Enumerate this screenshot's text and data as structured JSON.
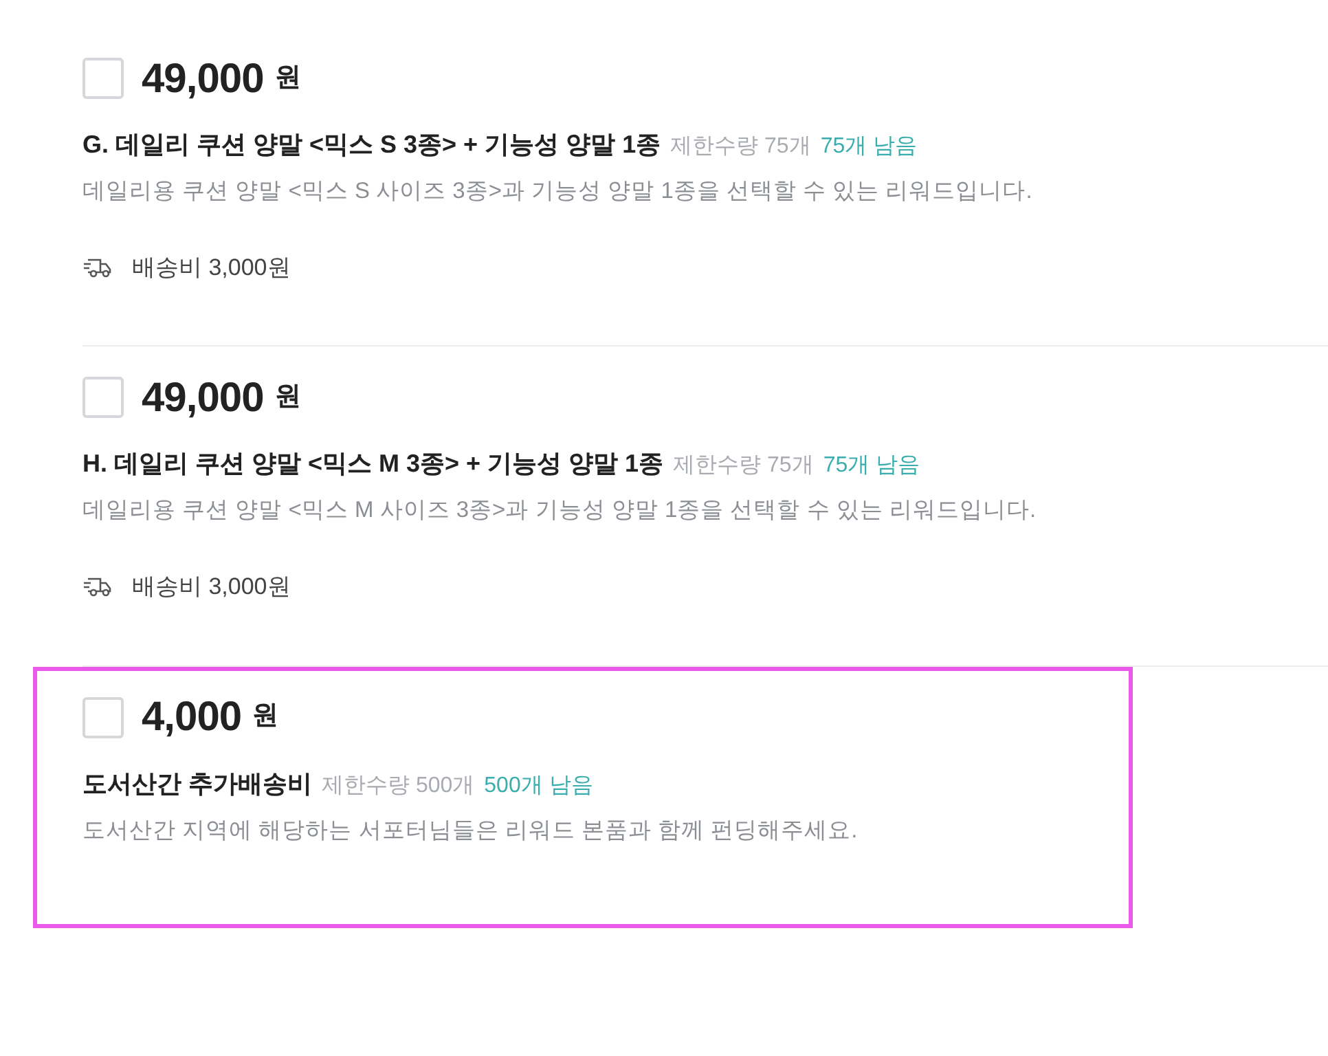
{
  "rewards": [
    {
      "checked": false,
      "highlighted": false,
      "price": "49,000",
      "currency": "원",
      "title": "G. 데일리 쿠션 양말 <믹스 S 3종> + 기능성 양말 1종",
      "limit": "제한수량 75개",
      "remaining": "75개 남음",
      "description": "데일리용 쿠션 양말 <믹스 S 사이즈 3종>과 기능성 양말 1종을 선택할 수 있는 리워드입니다.",
      "shipping": "배송비 3,000원"
    },
    {
      "checked": false,
      "highlighted": false,
      "price": "49,000",
      "currency": "원",
      "title": "H. 데일리 쿠션 양말 <믹스 M 3종> + 기능성 양말 1종",
      "limit": "제한수량 75개",
      "remaining": "75개 남음",
      "description": "데일리용 쿠션 양말 <믹스 M 사이즈 3종>과 기능성 양말 1종을 선택할 수 있는 리워드입니다.",
      "shipping": "배송비 3,000원"
    },
    {
      "checked": false,
      "highlighted": true,
      "price": "4,000",
      "currency": "원",
      "title": "도서산간 추가배송비",
      "limit": "제한수량 500개",
      "remaining": "500개 남음",
      "description": "도서산간 지역에 해당하는 서포터님들은 리워드 본품과 함께 펀딩해주세요."
    }
  ]
}
